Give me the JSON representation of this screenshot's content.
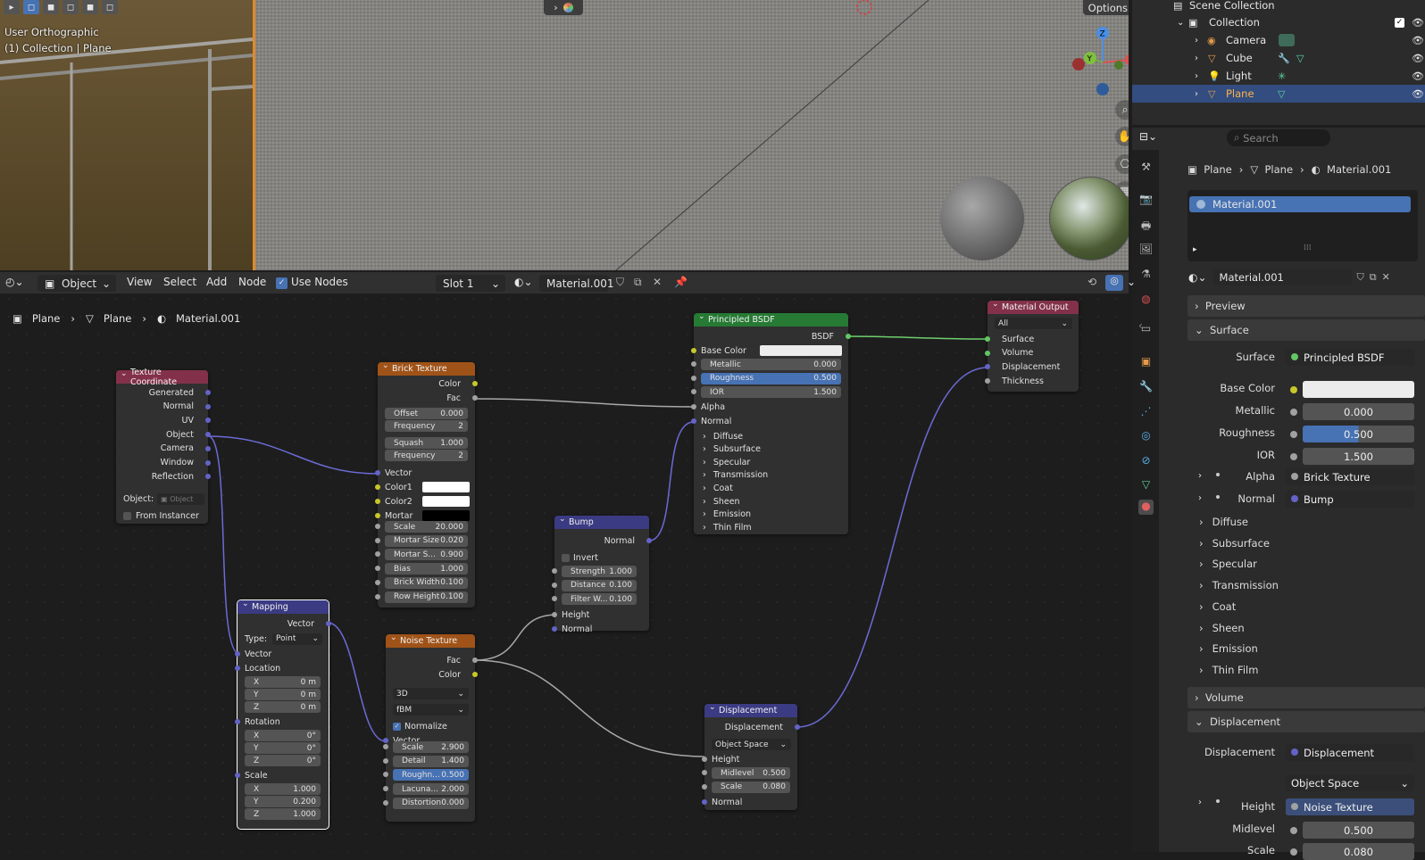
{
  "viewport": {
    "view_name": "User Orthographic",
    "context": "(1) Collection | Plane",
    "options_label": "Options"
  },
  "outliner": {
    "scene_label": "Scene Collection",
    "collection_label": "Collection",
    "items": [
      "Camera",
      "Cube",
      "Light",
      "Plane"
    ]
  },
  "props": {
    "search_placeholder": "Search",
    "breadcrumb": [
      "Plane",
      "Plane",
      "Material.001"
    ],
    "slot_name": "Material.001",
    "material_name": "Material.001",
    "sections": {
      "preview": "Preview",
      "surface": "Surface",
      "volume": "Volume",
      "displacement": "Displacement"
    },
    "surface": {
      "label": "Surface",
      "value": "Principled BSDF"
    },
    "base_color_label": "Base Color",
    "metallic": {
      "label": "Metallic",
      "value": "0.000"
    },
    "roughness": {
      "label": "Roughness",
      "value": "0.500"
    },
    "ior": {
      "label": "IOR",
      "value": "1.500"
    },
    "alpha": {
      "label": "Alpha",
      "value": "Brick Texture"
    },
    "normal": {
      "label": "Normal",
      "value": "Bump"
    },
    "subpanels": [
      "Diffuse",
      "Subsurface",
      "Specular",
      "Transmission",
      "Coat",
      "Sheen",
      "Emission",
      "Thin Film"
    ],
    "disp": {
      "label": "Displacement",
      "value": "Displacement",
      "space": "Object Space",
      "height_label": "Height",
      "height_value": "Noise Texture",
      "midlevel_label": "Midlevel",
      "midlevel": "0.500",
      "scale_label": "Scale",
      "scale": "0.080"
    }
  },
  "node_header": {
    "editor_mode": "Object",
    "menus": [
      "View",
      "Select",
      "Add",
      "Node"
    ],
    "use_nodes": "Use Nodes",
    "slot": "Slot 1",
    "material": "Material.001",
    "breadcrumb": [
      "Plane",
      "Plane",
      "Material.001"
    ]
  },
  "nodes": {
    "texcoord": {
      "title": "Texture Coordinate",
      "outputs": [
        "Generated",
        "Normal",
        "UV",
        "Object",
        "Camera",
        "Window",
        "Reflection"
      ],
      "object_label": "Object:",
      "object_ph": "Object",
      "from_instancer": "From Instancer"
    },
    "mapping": {
      "title": "Mapping",
      "out": "Vector",
      "type_label": "Type:",
      "type": "Point",
      "vector": "Vector",
      "location": "Location",
      "loc": [
        [
          "X",
          "0 m"
        ],
        [
          "Y",
          "0 m"
        ],
        [
          "Z",
          "0 m"
        ]
      ],
      "rotation": "Rotation",
      "rot": [
        [
          "X",
          "0°"
        ],
        [
          "Y",
          "0°"
        ],
        [
          "Z",
          "0°"
        ]
      ],
      "scale": "Scale",
      "scl": [
        [
          "X",
          "1.000"
        ],
        [
          "Y",
          "0.200"
        ],
        [
          "Z",
          "1.000"
        ]
      ]
    },
    "brick": {
      "title": "Brick Texture",
      "out_color": "Color",
      "out_fac": "Fac",
      "fields1": [
        [
          "Offset",
          "0.000"
        ],
        [
          "Frequency",
          "2"
        ]
      ],
      "fields2": [
        [
          "Squash",
          "1.000"
        ],
        [
          "Frequency",
          "2"
        ]
      ],
      "vector": "Vector",
      "color1": "Color1",
      "color2": "Color2",
      "mortar": "Mortar",
      "fields3": [
        [
          "Scale",
          "20.000"
        ],
        [
          "Mortar Size",
          "0.020"
        ],
        [
          "Mortar S...",
          "0.900"
        ],
        [
          "Bias",
          "1.000"
        ],
        [
          "Brick Width",
          "0.100"
        ],
        [
          "Row Height",
          "0.100"
        ]
      ]
    },
    "noise": {
      "title": "Noise Texture",
      "out_fac": "Fac",
      "out_color": "Color",
      "dim": "3D",
      "type": "fBM",
      "normalize": "Normalize",
      "vector": "Vector",
      "fields": [
        [
          "Scale",
          "2.900"
        ],
        [
          "Detail",
          "1.400"
        ],
        [
          "Roughn...",
          "0.500"
        ],
        [
          "Lacuna...",
          "2.000"
        ],
        [
          "Distortion",
          "0.000"
        ]
      ]
    },
    "bump": {
      "title": "Bump",
      "out": "Normal",
      "invert": "Invert",
      "fields": [
        [
          "Strength",
          "1.000"
        ],
        [
          "Distance",
          "0.100"
        ],
        [
          "Filter W...",
          "0.100"
        ]
      ],
      "height": "Height",
      "normal": "Normal"
    },
    "bsdf": {
      "title": "Principled BSDF",
      "out": "BSDF",
      "base_color": "Base Color",
      "fields": [
        [
          "Metallic",
          "0.000"
        ],
        [
          "Roughness",
          "0.500"
        ],
        [
          "IOR",
          "1.500"
        ]
      ],
      "alpha": "Alpha",
      "normal": "Normal",
      "panels": [
        "Diffuse",
        "Subsurface",
        "Specular",
        "Transmission",
        "Coat",
        "Sheen",
        "Emission",
        "Thin Film"
      ]
    },
    "output": {
      "title": "Material Output",
      "target": "All",
      "inputs": [
        "Surface",
        "Volume",
        "Displacement",
        "Thickness"
      ]
    },
    "disp": {
      "title": "Displacement",
      "out": "Displacement",
      "space": "Object Space",
      "height": "Height",
      "fields": [
        [
          "Midlevel",
          "0.500"
        ],
        [
          "Scale",
          "0.080"
        ]
      ],
      "normal": "Normal"
    }
  }
}
